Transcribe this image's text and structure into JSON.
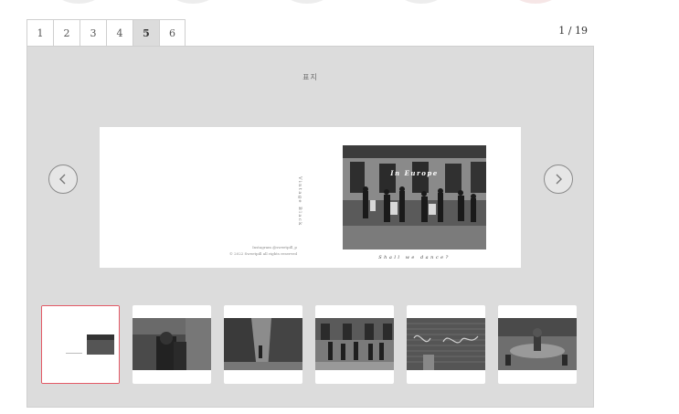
{
  "tabs": [
    {
      "label": "1"
    },
    {
      "label": "2"
    },
    {
      "label": "3"
    },
    {
      "label": "4"
    },
    {
      "label": "5",
      "active": true
    },
    {
      "label": "6"
    }
  ],
  "page_count": "1 / 19",
  "cover": {
    "title": "표지",
    "spine_text": "Vintage Black",
    "back_credit_line1": "Instagram @sweetpill_p",
    "back_credit_line2": "© 2022 Sweetpill all rights reserved",
    "photo_title": "In Europe",
    "front_caption": "Shall we dance?"
  },
  "nav": {
    "prev": "previous-page",
    "next": "next-page"
  },
  "thumbnails": [
    {
      "name": "cover",
      "active": true
    },
    {
      "name": "street-couple"
    },
    {
      "name": "narrow-alley"
    },
    {
      "name": "dancers"
    },
    {
      "name": "graffiti-shutter"
    },
    {
      "name": "fountain-plaza"
    }
  ],
  "colors": {
    "accent": "#e35a66",
    "panel": "#dcdcdc",
    "tab_active": "#dcdcdc"
  }
}
